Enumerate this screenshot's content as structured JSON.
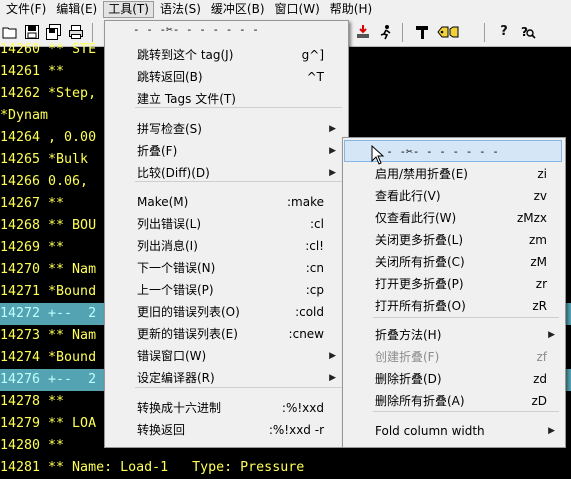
{
  "menubar": [
    {
      "label": "文件(F)"
    },
    {
      "label": "编辑(E)"
    },
    {
      "label": "工具(T)",
      "active": true
    },
    {
      "label": "语法(S)"
    },
    {
      "label": "缓冲区(B)"
    },
    {
      "label": "窗口(W)"
    },
    {
      "label": "帮助(H)"
    }
  ],
  "toolbar_icons": [
    "open-icon",
    "save-icon",
    "save-all-icon",
    "print-icon",
    "run-icon",
    "jump-icon",
    "make-icon",
    "tag-icon",
    "help-icon",
    "find-help-icon"
  ],
  "editor": {
    "lines": [
      {
        "num": "14260",
        "text": " ** STE",
        "hl": false
      },
      {
        "num": "14261",
        "text": " **",
        "hl": false
      },
      {
        "num": "14262",
        "text": " *Step,",
        "hl": false
      },
      {
        "num": "",
        "text": "*Dynam",
        "hl": false
      },
      {
        "num": "14264",
        "text": " , 0.00",
        "hl": false
      },
      {
        "num": "14265",
        "text": " *Bulk",
        "hl": false
      },
      {
        "num": "14266",
        "text": " 0.06,",
        "hl": false
      },
      {
        "num": "14267",
        "text": " **",
        "hl": false
      },
      {
        "num": "14268",
        "text": " ** BOU",
        "hl": false
      },
      {
        "num": "14269",
        "text": " **",
        "hl": false
      },
      {
        "num": "14270",
        "text": " ** Nam",
        "hl": false
      },
      {
        "num": "14271",
        "text": " *Bound",
        "hl": false
      },
      {
        "num": "14272",
        "text": " +--  2",
        "hl": true
      },
      {
        "num": "14273",
        "text": " ** Nam",
        "hl": false
      },
      {
        "num": "14274",
        "text": " *Bound",
        "hl": false
      },
      {
        "num": "14276",
        "text": " +--  2",
        "hl": true
      },
      {
        "num": "14278",
        "text": " **",
        "hl": false
      },
      {
        "num": "14279",
        "text": " ** LOA",
        "hl": false
      },
      {
        "num": "14280",
        "text": " **",
        "hl": false
      },
      {
        "num": "14281",
        "text": " ** Name: Load-1   Type: Pressure",
        "hl": false
      }
    ]
  },
  "tools_menu": {
    "tearoff": "- - -✂- - - - - - -",
    "items": [
      {
        "label": "跳转到这个 tag(J)",
        "acc": "g^]"
      },
      {
        "label": "跳转返回(B)",
        "acc": "^T"
      },
      {
        "label": "建立 Tags 文件(T)",
        "acc": ""
      },
      {
        "label": "拼写检查(S)",
        "acc": "",
        "sub": true
      },
      {
        "label": "折叠(F)",
        "acc": "",
        "sub": true
      },
      {
        "label": "比较(Diff)(D)",
        "acc": "",
        "sub": true
      },
      {
        "label": "Make(M)",
        "acc": ":make"
      },
      {
        "label": "列出错误(L)",
        "acc": ":cl"
      },
      {
        "label": "列出消息(I)",
        "acc": ":cl!"
      },
      {
        "label": "下一个错误(N)",
        "acc": ":cn"
      },
      {
        "label": "上一个错误(P)",
        "acc": ":cp"
      },
      {
        "label": "更旧的错误列表(O)",
        "acc": ":cold"
      },
      {
        "label": "更新的错误列表(E)",
        "acc": ":cnew"
      },
      {
        "label": "错误窗口(W)",
        "acc": "",
        "sub": true
      },
      {
        "label": "设定编译器(R)",
        "acc": "",
        "sub": true
      },
      {
        "label": "转换成十六进制",
        "acc": ":%!xxd"
      },
      {
        "label": "转换返回",
        "acc": ":%!xxd -r"
      }
    ]
  },
  "fold_menu": {
    "tearoff": "- - -✂- - - - - - -",
    "items": [
      {
        "label": "启用/禁用折叠(E)",
        "acc": "zi"
      },
      {
        "label": "查看此行(V)",
        "acc": "zv"
      },
      {
        "label": "仅查看此行(W)",
        "acc": "zMzx"
      },
      {
        "label": "关闭更多折叠(L)",
        "acc": "zm"
      },
      {
        "label": "关闭所有折叠(C)",
        "acc": "zM"
      },
      {
        "label": "打开更多折叠(P)",
        "acc": "zr"
      },
      {
        "label": "打开所有折叠(O)",
        "acc": "zR"
      },
      {
        "label": "折叠方法(H)",
        "acc": "",
        "sub": true
      },
      {
        "label": "创建折叠(F)",
        "acc": "zf",
        "disabled": true
      },
      {
        "label": "删除折叠(D)",
        "acc": "zd"
      },
      {
        "label": "删除所有折叠(A)",
        "acc": "zD"
      },
      {
        "label": "Fold column width",
        "acc": "",
        "sub": true
      }
    ]
  }
}
